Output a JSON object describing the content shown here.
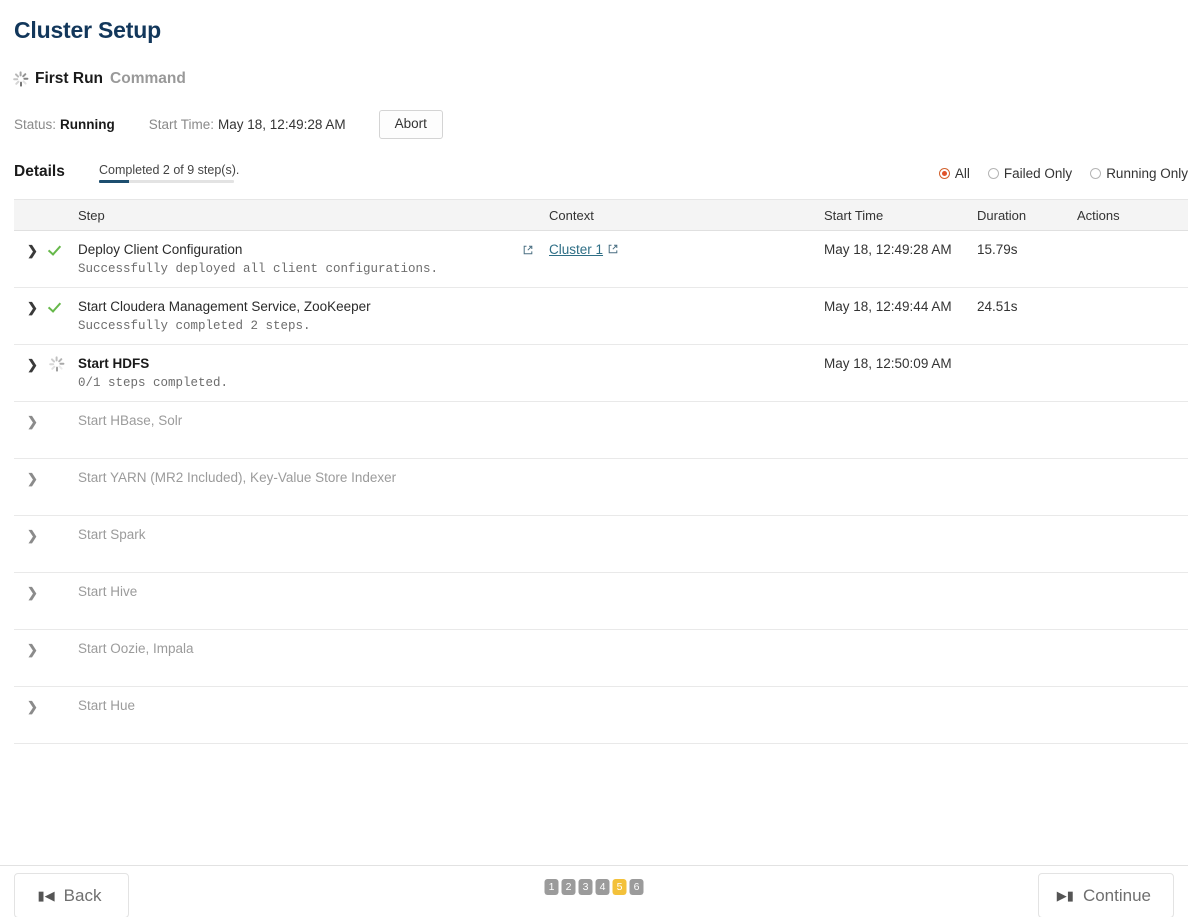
{
  "page": {
    "title": "Cluster Setup"
  },
  "command": {
    "spinner_icon": "spinner-icon",
    "name": "First Run",
    "suffix": "Command",
    "status_label": "Status:",
    "status_value": "Running",
    "start_time_label": "Start Time:",
    "start_time_value": "May 18, 12:49:28 AM",
    "abort_label": "Abort"
  },
  "details": {
    "label": "Details",
    "progress_text": "Completed 2 of 9 step(s).",
    "progress_percent": 22,
    "progress_fill_color": "#1d4e6f",
    "progress_track_color": "#e3e3e3"
  },
  "filters": {
    "selected": "All",
    "options": [
      {
        "label": "All",
        "checked": true
      },
      {
        "label": "Failed Only",
        "checked": false
      },
      {
        "label": "Running Only",
        "checked": false
      }
    ],
    "accent_color": "#e0532a"
  },
  "table": {
    "columns": [
      "Step",
      "Context",
      "Start Time",
      "Duration",
      "Actions"
    ],
    "rows": [
      {
        "expand_icon": "chevron-right-icon",
        "status_icon": "check-success-icon",
        "step": "Deploy Client Configuration",
        "description": "Successfully deployed all client configurations.",
        "has_inline_external_link": true,
        "context": "Cluster 1",
        "context_external_icon": "external-link-icon",
        "start_time": "May 18, 12:49:28 AM",
        "duration": "15.79s",
        "actions": "",
        "state": "success"
      },
      {
        "expand_icon": "chevron-right-icon",
        "status_icon": "check-success-icon",
        "step": "Start Cloudera Management Service, ZooKeeper",
        "description": "Successfully completed 2 steps.",
        "has_inline_external_link": false,
        "context": "",
        "start_time": "May 18, 12:49:44 AM",
        "duration": "24.51s",
        "actions": "",
        "state": "success"
      },
      {
        "expand_icon": "chevron-right-icon",
        "status_icon": "spinner-icon",
        "step": "Start HDFS",
        "description": "0/1 steps completed.",
        "has_inline_external_link": false,
        "context": "",
        "start_time": "May 18, 12:50:09 AM",
        "duration": "",
        "actions": "",
        "state": "running"
      },
      {
        "expand_icon": "chevron-right-icon",
        "status_icon": "",
        "step": "Start HBase, Solr",
        "description": "",
        "has_inline_external_link": false,
        "context": "",
        "start_time": "",
        "duration": "",
        "actions": "",
        "state": "pending"
      },
      {
        "expand_icon": "chevron-right-icon",
        "status_icon": "",
        "step": "Start YARN (MR2 Included), Key-Value Store Indexer",
        "description": "",
        "has_inline_external_link": false,
        "context": "",
        "start_time": "",
        "duration": "",
        "actions": "",
        "state": "pending"
      },
      {
        "expand_icon": "chevron-right-icon",
        "status_icon": "",
        "step": "Start Spark",
        "description": "",
        "has_inline_external_link": false,
        "context": "",
        "start_time": "",
        "duration": "",
        "actions": "",
        "state": "pending"
      },
      {
        "expand_icon": "chevron-right-icon",
        "status_icon": "",
        "step": "Start Hive",
        "description": "",
        "has_inline_external_link": false,
        "context": "",
        "start_time": "",
        "duration": "",
        "actions": "",
        "state": "pending"
      },
      {
        "expand_icon": "chevron-right-icon",
        "status_icon": "",
        "step": "Start Oozie, Impala",
        "description": "",
        "has_inline_external_link": false,
        "context": "",
        "start_time": "",
        "duration": "",
        "actions": "",
        "state": "pending"
      },
      {
        "expand_icon": "chevron-right-icon",
        "status_icon": "",
        "step": "Start Hue",
        "description": "",
        "has_inline_external_link": false,
        "context": "",
        "start_time": "",
        "duration": "",
        "actions": "",
        "state": "pending"
      }
    ]
  },
  "footer": {
    "back_label": "Back",
    "back_icon": "skip-to-start-icon",
    "continue_label": "Continue",
    "continue_icon": "skip-to-end-icon",
    "pager": [
      {
        "label": "1",
        "active": false
      },
      {
        "label": "2",
        "active": false
      },
      {
        "label": "3",
        "active": false
      },
      {
        "label": "4",
        "active": false
      },
      {
        "label": "5",
        "active": true
      },
      {
        "label": "6",
        "active": false
      }
    ],
    "pager_active_color": "#f3c13a",
    "pager_inactive_color": "#9b9b9b"
  }
}
